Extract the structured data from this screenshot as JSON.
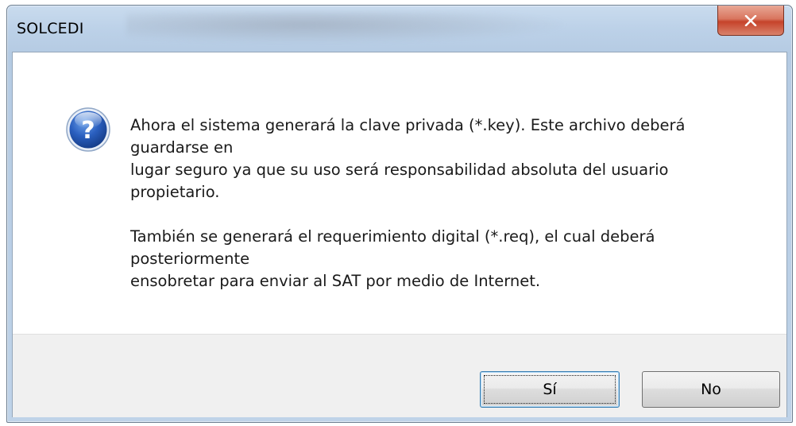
{
  "window": {
    "title": "SOLCEDI"
  },
  "message": {
    "paragraph1": "Ahora el sistema generará la clave privada (*.key). Este archivo deberá\nguardarse en\nlugar seguro ya que su uso será responsabilidad absoluta del usuario\npropietario.",
    "paragraph2": "También se generará el requerimiento digital (*.req), el cual deberá\nposteriormente\nensobretar para enviar al SAT por medio de Internet."
  },
  "buttons": {
    "yes_label": "Sí",
    "no_label": "No"
  },
  "icons": {
    "message_icon": "question-icon",
    "close_icon": "close-icon"
  },
  "colors": {
    "close_button": "#c6432b",
    "question_icon": "#1f4fa3",
    "default_button_border": "#3c7fb1"
  }
}
